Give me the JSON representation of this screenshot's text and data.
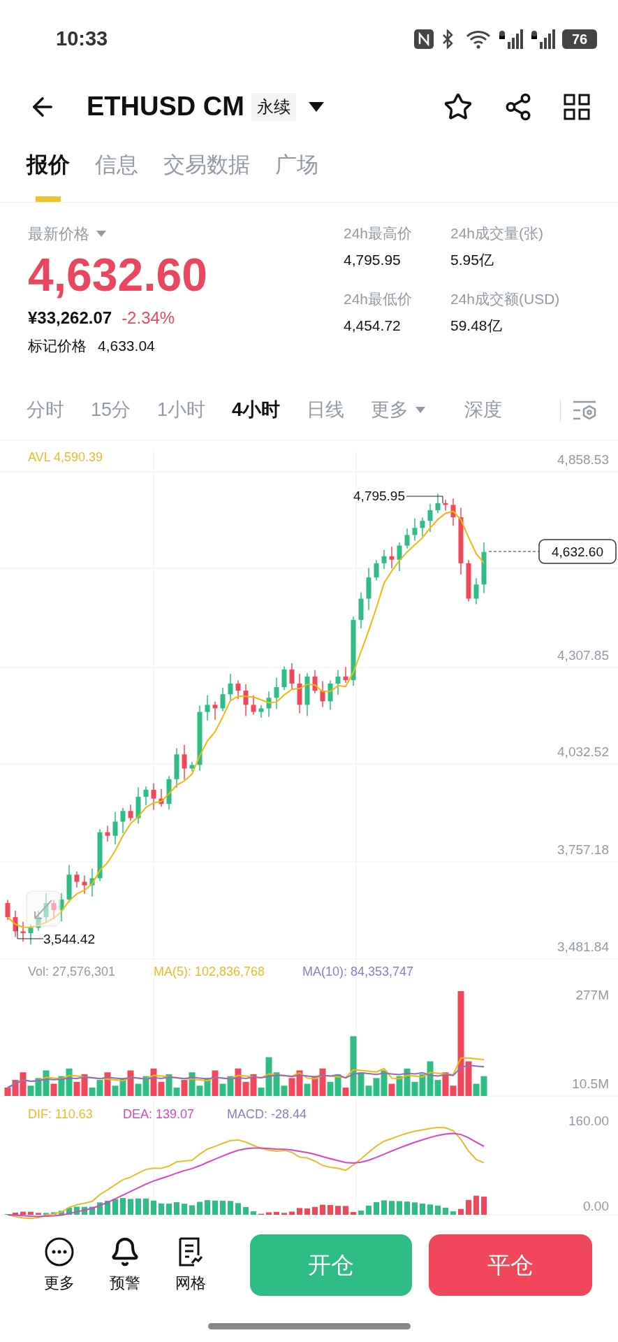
{
  "status_bar": {
    "time": "10:33",
    "battery": "76"
  },
  "header": {
    "symbol": "ETHUSD CM",
    "badge": "永续"
  },
  "tabs": [
    {
      "label": "报价",
      "selected": true
    },
    {
      "label": "信息",
      "selected": false
    },
    {
      "label": "交易数据",
      "selected": false
    },
    {
      "label": "广场",
      "selected": false
    }
  ],
  "quote": {
    "label": "最新价格",
    "price": "4,632.60",
    "cny": "¥33,262.07",
    "change": "-2.34%",
    "mark_label": "标记价格",
    "mark_value": "4,633.04"
  },
  "stats": [
    {
      "label": "24h最高价",
      "value": "4,795.95"
    },
    {
      "label": "24h成交量(张)",
      "value": "5.95亿"
    },
    {
      "label": "24h最低价",
      "value": "4,454.72"
    },
    {
      "label": "24h成交额(USD)",
      "value": "59.48亿"
    }
  ],
  "intervals": [
    {
      "label": "分时",
      "selected": false,
      "kind": "plain"
    },
    {
      "label": "15分",
      "selected": false,
      "kind": "plain"
    },
    {
      "label": "1小时",
      "selected": false,
      "kind": "plain"
    },
    {
      "label": "4小时",
      "selected": true,
      "kind": "plain"
    },
    {
      "label": "日线",
      "selected": false,
      "kind": "plain"
    },
    {
      "label": "更多",
      "selected": false,
      "kind": "menu"
    },
    {
      "label": "深度",
      "selected": false,
      "kind": "plain"
    }
  ],
  "chart": {
    "avl": "AVL 4,590.39",
    "price_ticks": [
      "4,858.53",
      "4,307.85",
      "4,032.52",
      "3,757.18",
      "3,481.84"
    ],
    "high_label": "4,795.95",
    "low_label": "3,544.42",
    "last_price": "4,632.60"
  },
  "volume": {
    "vol": "Vol: 27,576,301",
    "ma5": "MA(5): 102,836,768",
    "ma10": "MA(10): 84,353,747",
    "ticks": [
      "277M",
      "10.5M"
    ]
  },
  "macd": {
    "dif": "DIF: 110.63",
    "dea": "DEA: 139.07",
    "macd": "MACD: -28.44",
    "ticks": [
      "160.00",
      "0.00"
    ]
  },
  "bottom": {
    "actions": [
      {
        "label": "更多",
        "kind": "more"
      },
      {
        "label": "预警",
        "kind": "alert"
      },
      {
        "label": "网格",
        "kind": "grid"
      }
    ],
    "buy": "开仓",
    "sell": "平仓"
  }
}
